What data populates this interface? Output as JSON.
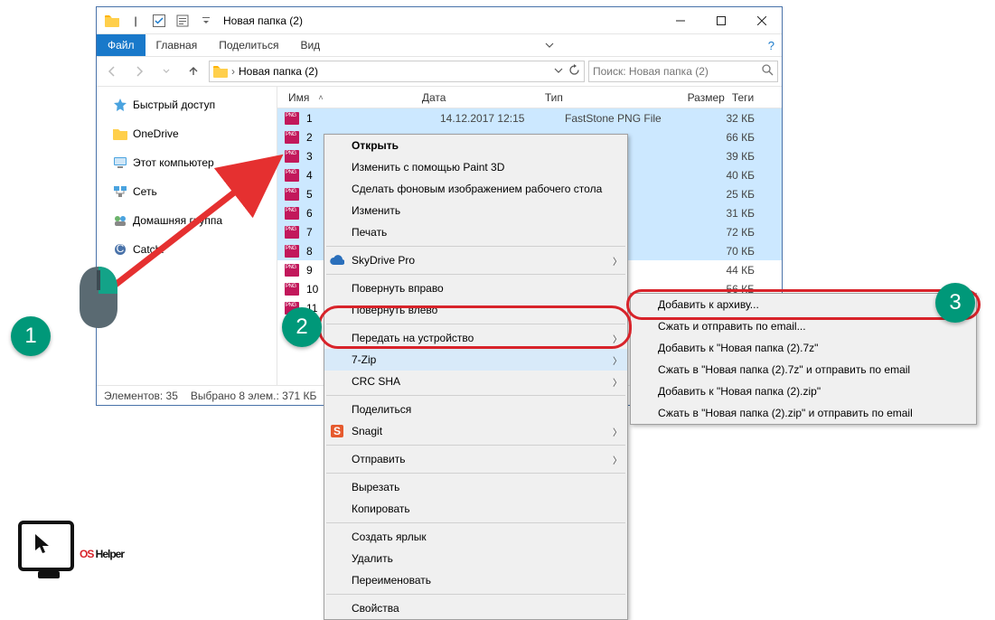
{
  "window": {
    "title": "Новая папка (2)",
    "qat_divider": "|"
  },
  "ribbon": {
    "tabs": [
      "Файл",
      "Главная",
      "Поделиться",
      "Вид"
    ]
  },
  "nav": {
    "crumbs": [
      "Новая папка (2)"
    ],
    "search_placeholder": "Поиск: Новая папка (2)"
  },
  "sidebar": {
    "items": [
      {
        "label": "Быстрый доступ"
      },
      {
        "label": "OneDrive"
      },
      {
        "label": "Этот компьютер"
      },
      {
        "label": "Сеть"
      },
      {
        "label": "Домашняя группа"
      },
      {
        "label": "Catch!"
      }
    ]
  },
  "columns": {
    "name": "Имя",
    "date": "Дата",
    "type": "Тип",
    "size": "Размер",
    "tags": "Теги"
  },
  "rows": [
    {
      "name": "1",
      "date": "14.12.2017 12:15",
      "type": "FastStone PNG File",
      "size": "32 КБ",
      "sel": true
    },
    {
      "name": "2",
      "date": "",
      "type": "",
      "size": "66 КБ",
      "sel": true
    },
    {
      "name": "3",
      "date": "",
      "type": "",
      "size": "39 КБ",
      "sel": true
    },
    {
      "name": "4",
      "date": "",
      "type": "",
      "size": "40 КБ",
      "sel": true
    },
    {
      "name": "5",
      "date": "",
      "type": "",
      "size": "25 КБ",
      "sel": true
    },
    {
      "name": "6",
      "date": "",
      "type": "",
      "size": "31 КБ",
      "sel": true
    },
    {
      "name": "7",
      "date": "",
      "type": "",
      "size": "72 КБ",
      "sel": true
    },
    {
      "name": "8",
      "date": "",
      "type": "",
      "size": "70 КБ",
      "sel": true
    },
    {
      "name": "9",
      "date": "",
      "type": "",
      "size": "44 КБ",
      "sel": false
    },
    {
      "name": "10",
      "date": "",
      "type": "",
      "size": "56 КБ",
      "sel": false
    },
    {
      "name": "11",
      "date": "",
      "type": "",
      "size": "",
      "sel": false
    }
  ],
  "status": {
    "total": "Элементов: 35",
    "selected": "Выбрано 8 элем.: 371 КБ"
  },
  "context_menu": {
    "items": [
      {
        "label": "Открыть",
        "bold": true
      },
      {
        "label": "Изменить с помощью Paint 3D"
      },
      {
        "label": "Сделать фоновым изображением рабочего стола"
      },
      {
        "label": "Изменить"
      },
      {
        "label": "Печать"
      },
      {
        "sep": true
      },
      {
        "label": "SkyDrive Pro",
        "icon": "cloud",
        "sub": true
      },
      {
        "sep": true
      },
      {
        "label": "Повернуть вправо"
      },
      {
        "label": "Повернуть влево"
      },
      {
        "sep": true
      },
      {
        "label": "Передать на устройство",
        "sub": true
      },
      {
        "label": "7-Zip",
        "sub": true,
        "hover": true
      },
      {
        "label": "CRC SHA",
        "sub": true
      },
      {
        "sep": true
      },
      {
        "label": "Поделиться"
      },
      {
        "label": "Snagit",
        "icon": "snagit",
        "sub": true
      },
      {
        "sep": true
      },
      {
        "label": "Отправить",
        "sub": true
      },
      {
        "sep": true
      },
      {
        "label": "Вырезать"
      },
      {
        "label": "Копировать"
      },
      {
        "sep": true
      },
      {
        "label": "Создать ярлык"
      },
      {
        "label": "Удалить"
      },
      {
        "label": "Переименовать"
      },
      {
        "sep": true
      },
      {
        "label": "Свойства"
      }
    ]
  },
  "submenu": {
    "items": [
      {
        "label": "Добавить к архиву..."
      },
      {
        "label": "Сжать и отправить по email..."
      },
      {
        "label": "Добавить к \"Новая папка (2).7z\""
      },
      {
        "label": "Сжать в \"Новая папка (2).7z\" и отправить по email"
      },
      {
        "label": "Добавить к \"Новая папка (2).zip\""
      },
      {
        "label": "Сжать в \"Новая папка (2).zip\" и отправить по email"
      }
    ]
  },
  "annotations": {
    "one": "1",
    "two": "2",
    "three": "3"
  },
  "logo": {
    "os": "OS",
    "helper": " Helper"
  }
}
